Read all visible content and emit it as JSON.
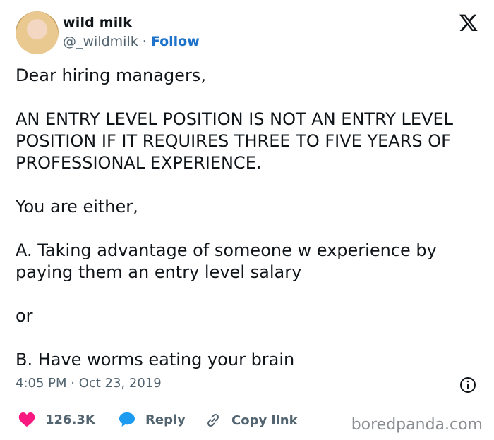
{
  "author": {
    "name": "wild milk",
    "handle": "@_wildmilk",
    "separator": "·",
    "follow_label": "Follow"
  },
  "platform_icon": "x-logo-icon",
  "post": {
    "text": "Dear hiring managers,\n\nAN ENTRY LEVEL POSITION IS NOT AN ENTRY LEVEL POSITION IF IT REQUIRES THREE TO FIVE YEARS OF PROFESSIONAL EXPERIENCE.\n\nYou are either,\n\nA. Taking advantage of someone w experience by paying them an entry level salary\n\nor\n\nB. Have worms eating your brain",
    "timestamp": "4:05 PM · Oct 23, 2019"
  },
  "actions": {
    "likes": "126.3K",
    "reply_label": "Reply",
    "copy_label": "Copy link"
  },
  "watermark": "boredpanda.com",
  "colors": {
    "follow": "#1d72c9",
    "heart": "#f91880",
    "reply_bubble": "#1d9bf0",
    "muted": "#536471"
  }
}
